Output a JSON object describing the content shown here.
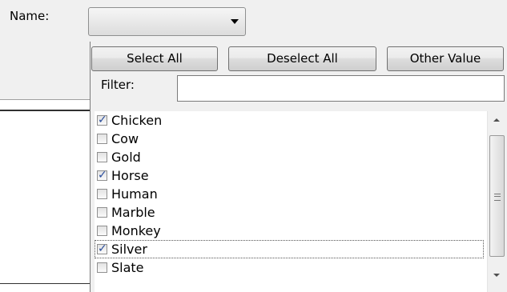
{
  "form": {
    "name_label": "Name:",
    "name_combo_value": ""
  },
  "dropdown": {
    "buttons": {
      "select_all": "Select All",
      "deselect_all": "Deselect All",
      "other_value": "Other Value"
    },
    "filter_label": "Filter:",
    "filter_value": "",
    "items": [
      {
        "label": "Chicken",
        "checked": true
      },
      {
        "label": "Cow",
        "checked": false
      },
      {
        "label": "Gold",
        "checked": false
      },
      {
        "label": "Horse",
        "checked": true
      },
      {
        "label": "Human",
        "checked": false
      },
      {
        "label": "Marble",
        "checked": false
      },
      {
        "label": "Monkey",
        "checked": false
      },
      {
        "label": "Silver",
        "checked": true,
        "focused": true
      },
      {
        "label": "Slate",
        "checked": false
      }
    ]
  },
  "colors": {
    "panel_bg": "#f0f0f0",
    "check_mark": "#2a4d9c"
  },
  "icons": {
    "combo_arrow": "chevron-down-icon",
    "scroll_up": "scroll-up-arrow-icon",
    "scroll_down": "scroll-down-arrow-icon"
  }
}
